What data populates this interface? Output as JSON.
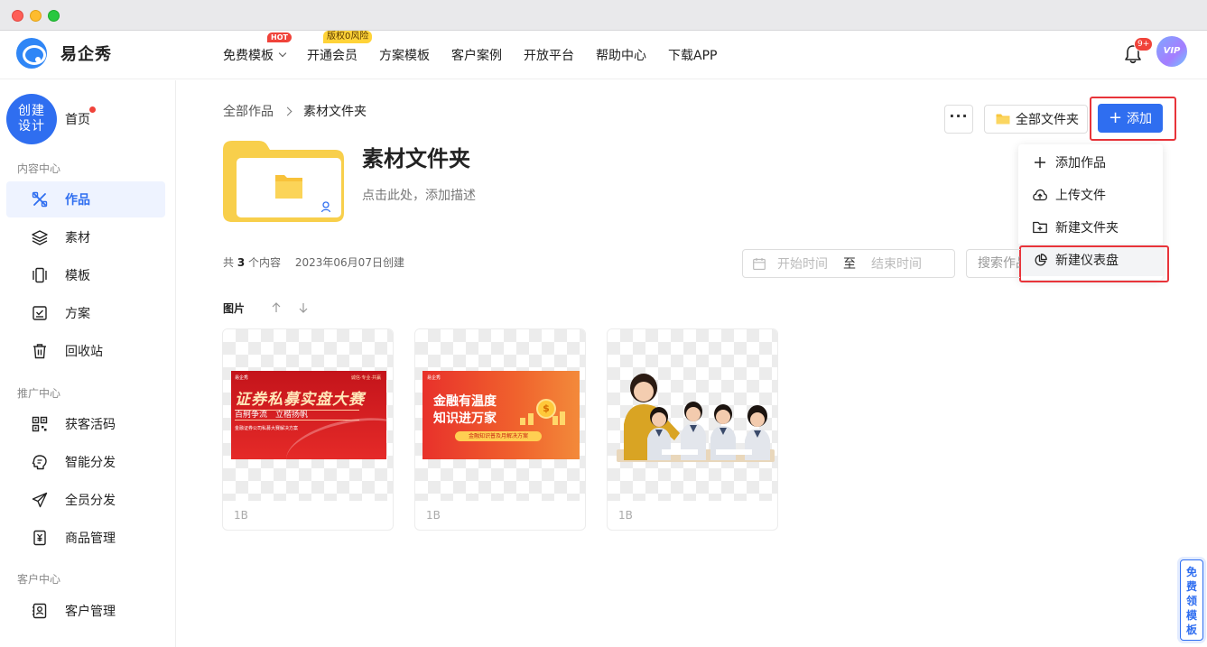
{
  "app": {
    "brand": "易企秀"
  },
  "nav": {
    "items": [
      {
        "label": "免费模板",
        "badge": "HOT"
      },
      {
        "label": "开通会员",
        "badge": "版权0风险"
      },
      {
        "label": "方案模板"
      },
      {
        "label": "客户案例"
      },
      {
        "label": "开放平台"
      },
      {
        "label": "帮助中心"
      },
      {
        "label": "下载APP"
      }
    ],
    "notification_count": "9+",
    "avatar_label": "VIP"
  },
  "sidebar": {
    "create_label_line1": "创建",
    "create_label_line2": "设计",
    "home": "首页",
    "sections": [
      {
        "title": "内容中心",
        "items": [
          {
            "label": "作品",
            "icon": "works-icon",
            "active": true
          },
          {
            "label": "素材",
            "icon": "layers-icon"
          },
          {
            "label": "模板",
            "icon": "template-icon"
          },
          {
            "label": "方案",
            "icon": "checklist-icon"
          },
          {
            "label": "回收站",
            "icon": "trash-icon"
          }
        ]
      },
      {
        "title": "推广中心",
        "items": [
          {
            "label": "获客活码",
            "icon": "qrcode-icon"
          },
          {
            "label": "智能分发",
            "icon": "brain-icon"
          },
          {
            "label": "全员分发",
            "icon": "send-icon"
          },
          {
            "label": "商品管理",
            "icon": "product-icon"
          }
        ]
      },
      {
        "title": "客户中心",
        "items": [
          {
            "label": "客户管理",
            "icon": "contacts-icon"
          }
        ]
      }
    ]
  },
  "breadcrumb": {
    "root": "全部作品",
    "current": "素材文件夹"
  },
  "toolbar": {
    "more": "···",
    "all_folders": "全部文件夹",
    "add": "添加",
    "add_plus": "+"
  },
  "dropdown": {
    "items": [
      {
        "label": "添加作品",
        "icon": "plus-icon"
      },
      {
        "label": "上传文件",
        "icon": "cloud-upload-icon"
      },
      {
        "label": "新建文件夹",
        "icon": "folder-plus-icon"
      },
      {
        "label": "新建仪表盘",
        "icon": "pie-chart-icon",
        "highlighted": true
      }
    ]
  },
  "folder": {
    "title": "素材文件夹",
    "description": "点击此处，添加描述"
  },
  "meta": {
    "prefix": "共",
    "count": "3",
    "suffix": "个内容",
    "created": "2023年06月07日创建"
  },
  "filters": {
    "start_placeholder": "开始时间",
    "to": "至",
    "end_placeholder": "结束时间",
    "search_placeholder": "搜索作品"
  },
  "list": {
    "section_label": "图片",
    "cards": [
      {
        "size": "1B",
        "banner": {
          "logo": "易企秀",
          "tag": "诚信·专业·共赢",
          "title": "证券私募实盘大赛",
          "subtitle": "百舸争流　立楷扬帆",
          "caption": "金融证券公司私募大赛解决方案"
        }
      },
      {
        "size": "1B",
        "banner": {
          "logo": "易企秀",
          "title_line1": "金融有温度",
          "title_line2": "知识进万家",
          "pill": "金融知识普及月解决方案",
          "coin": "$"
        }
      },
      {
        "size": "1B",
        "banner": {}
      }
    ]
  },
  "floating_tab": {
    "chars": [
      "免",
      "费",
      "领",
      "模",
      "板"
    ]
  },
  "colors": {
    "accent": "#2f6ef0",
    "alert": "#e8343a",
    "folder": "#f8cf4b"
  }
}
